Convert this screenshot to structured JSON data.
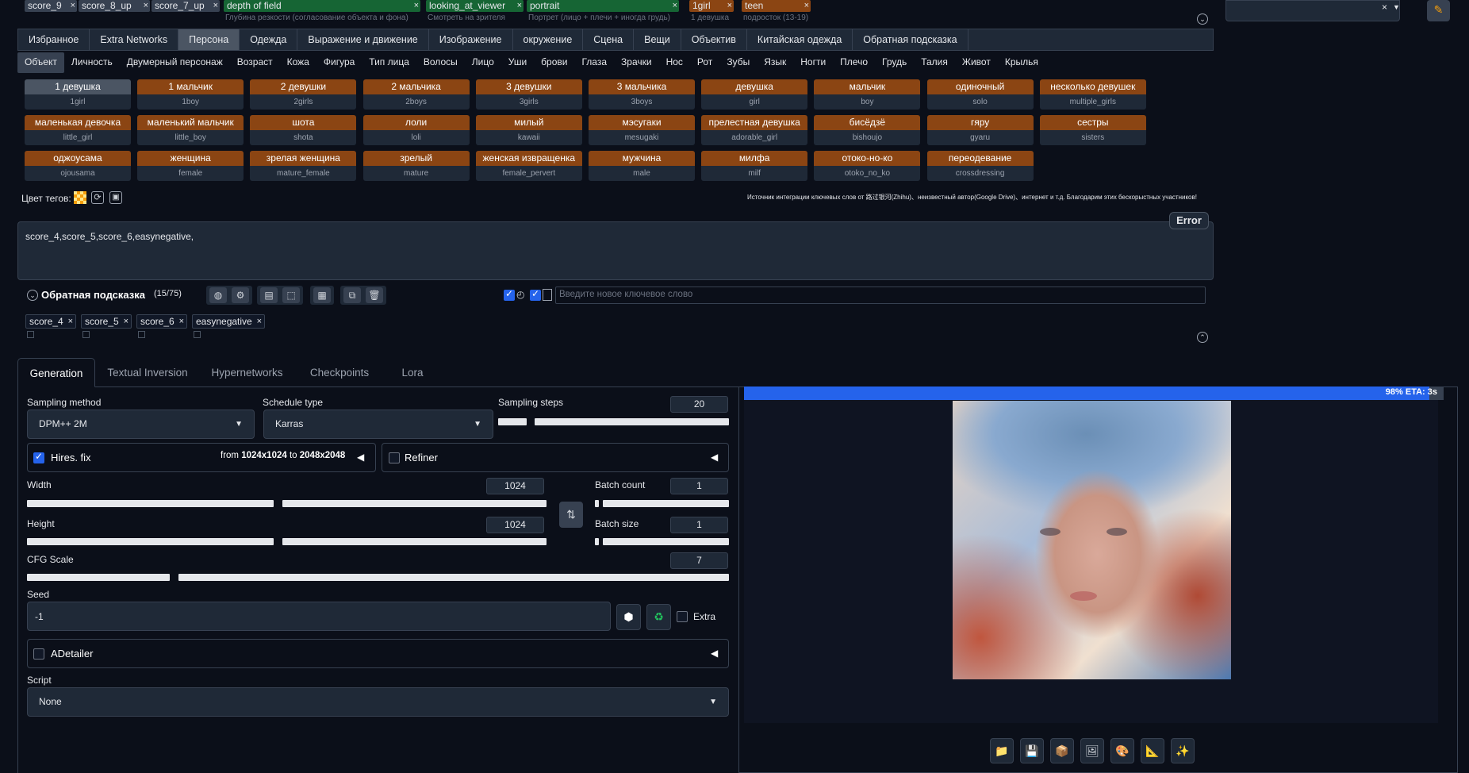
{
  "top_chips": [
    {
      "label": "score_9",
      "hint": "",
      "color": "#374151"
    },
    {
      "label": "score_8_up",
      "hint": "",
      "color": "#374151"
    },
    {
      "label": "score_7_up",
      "hint": "",
      "color": "#374151"
    },
    {
      "label": "depth of field",
      "hint": "Глубина резкости (согласование объекта и фона)",
      "color": "#166534"
    },
    {
      "label": "looking_at_viewer",
      "hint": "Смотреть на зрителя",
      "color": "#166534"
    },
    {
      "label": "portrait",
      "hint": "Портрет (лицо + плечи + иногда грудь)",
      "color": "#166534"
    },
    {
      "label": "1girl",
      "hint": "1 девушка",
      "color": "#8b4513"
    },
    {
      "label": "teen",
      "hint": "подросток (13-19)",
      "color": "#8b4513"
    }
  ],
  "category_tabs": [
    "Избранное",
    "Extra Networks",
    "Персона",
    "Одежда",
    "Выражение и движение",
    "Изображение",
    "окружение",
    "Сцена",
    "Вещи",
    "Объектив",
    "Китайская одежда",
    "Обратная подсказка"
  ],
  "category_active": "Персона",
  "subcategory_tabs": [
    "Объект",
    "Личность",
    "Двумерный персонаж",
    "Возраст",
    "Кожа",
    "Фигура",
    "Тип лица",
    "Волосы",
    "Лицо",
    "Уши",
    "брови",
    "Глаза",
    "Зрачки",
    "Нос",
    "Рот",
    "Зубы",
    "Язык",
    "Ногти",
    "Плечо",
    "Грудь",
    "Талия",
    "Живот",
    "Крылья"
  ],
  "subcategory_active": "Объект",
  "keywords": [
    {
      "ru": "1 девушка",
      "en": "1girl",
      "selected": true
    },
    {
      "ru": "1 мальчик",
      "en": "1boy"
    },
    {
      "ru": "2 девушки",
      "en": "2girls"
    },
    {
      "ru": "2 мальчика",
      "en": "2boys"
    },
    {
      "ru": "3 девушки",
      "en": "3girls"
    },
    {
      "ru": "3 мальчика",
      "en": "3boys"
    },
    {
      "ru": "девушка",
      "en": "girl"
    },
    {
      "ru": "мальчик",
      "en": "boy"
    },
    {
      "ru": "одиночный",
      "en": "solo"
    },
    {
      "ru": "несколько девушек",
      "en": "multiple_girls"
    },
    {
      "ru": "маленькая девочка",
      "en": "little_girl"
    },
    {
      "ru": "маленький мальчик",
      "en": "little_boy"
    },
    {
      "ru": "шота",
      "en": "shota"
    },
    {
      "ru": "лоли",
      "en": "loli"
    },
    {
      "ru": "милый",
      "en": "kawaii"
    },
    {
      "ru": "мэсугаки",
      "en": "mesugaki"
    },
    {
      "ru": "прелестная девушка",
      "en": "adorable_girl"
    },
    {
      "ru": "бисёдзё",
      "en": "bishoujo"
    },
    {
      "ru": "гяру",
      "en": "gyaru"
    },
    {
      "ru": "сестры",
      "en": "sisters"
    },
    {
      "ru": "оджоусама",
      "en": "ojousama"
    },
    {
      "ru": "женщина",
      "en": "female"
    },
    {
      "ru": "зрелая женщина",
      "en": "mature_female"
    },
    {
      "ru": "зрелый",
      "en": "mature"
    },
    {
      "ru": "женская извращенка",
      "en": "female_pervert"
    },
    {
      "ru": "мужчина",
      "en": "male"
    },
    {
      "ru": "милфа",
      "en": "milf"
    },
    {
      "ru": "отоко-но-ко",
      "en": "otoko_no_ko"
    },
    {
      "ru": "переодевание",
      "en": "crossdressing"
    }
  ],
  "tag_color_label": "Цвет тегов:",
  "source_note": "Источник интеграции ключевых слов от 路过银河(Zhihu)、неизвестный автор(Google Drive)、интернет и т.д. Благодарим этих бескорыстных участников!",
  "negative": {
    "error_label": "Error",
    "text": "score_4,score_5,score_6,easynegative,",
    "title": "Обратная подсказка",
    "count": "(15/75)",
    "keyword_placeholder": "Введите новое ключевое слово",
    "chips": [
      "score_4",
      "score_5",
      "score_6",
      "easynegative"
    ]
  },
  "main_tabs": [
    "Generation",
    "Textual Inversion",
    "Hypernetworks",
    "Checkpoints",
    "Lora"
  ],
  "main_tab_active": "Generation",
  "sampling_method": {
    "label": "Sampling method",
    "value": "DPM++ 2M"
  },
  "schedule_type": {
    "label": "Schedule type",
    "value": "Karras"
  },
  "sampling_steps": {
    "label": "Sampling steps",
    "value": "20"
  },
  "hires": {
    "label": "Hires. fix",
    "info_from": "from",
    "from_val": "1024x1024",
    "info_to": "to",
    "to_val": "2048x2048"
  },
  "refiner": {
    "label": "Refiner"
  },
  "width": {
    "label": "Width",
    "value": "1024"
  },
  "height": {
    "label": "Height",
    "value": "1024"
  },
  "batch_count": {
    "label": "Batch count",
    "value": "1"
  },
  "batch_size": {
    "label": "Batch size",
    "value": "1"
  },
  "cfg": {
    "label": "CFG Scale",
    "value": "7"
  },
  "seed": {
    "label": "Seed",
    "value": "-1",
    "extra_label": "Extra"
  },
  "adetailer": {
    "label": "ADetailer"
  },
  "script": {
    "label": "Script",
    "value": "None"
  },
  "progress": {
    "text": "98% ETA: 3s",
    "fraction": 0.98
  },
  "colors": {
    "accent": "#2563eb",
    "keyword_bg": "#8b4513",
    "panel": "#1f2937",
    "background": "#0b0f19"
  }
}
